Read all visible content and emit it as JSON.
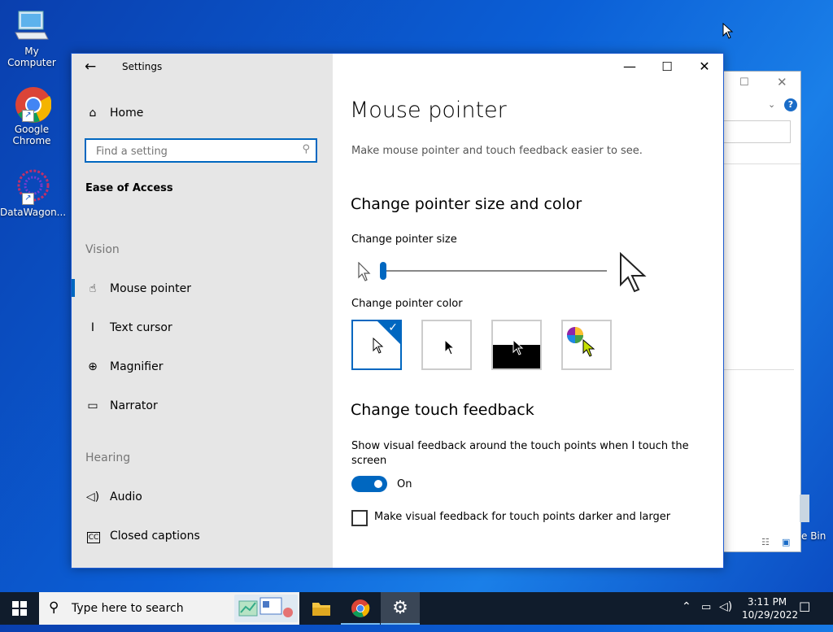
{
  "desktop": {
    "icons": [
      {
        "label": "My Computer"
      },
      {
        "label": "Google Chrome"
      },
      {
        "label": "DataWagon..."
      }
    ],
    "recycle_bin_label_partial": "e Bin"
  },
  "window": {
    "title": "Settings",
    "back_icon": "back-arrow-icon",
    "controls": {
      "minimize": "minimize-icon",
      "maximize": "maximize-icon",
      "close": "close-icon"
    }
  },
  "sidebar": {
    "home_label": "Home",
    "search_placeholder": "Find a setting",
    "category": "Ease of Access",
    "sections": [
      {
        "title": "Vision",
        "items": [
          {
            "label": "Mouse pointer",
            "icon": "mouse-pointer-icon",
            "selected": true
          },
          {
            "label": "Text cursor",
            "icon": "text-cursor-icon"
          },
          {
            "label": "Magnifier",
            "icon": "magnifier-icon"
          },
          {
            "label": "Narrator",
            "icon": "narrator-icon"
          }
        ]
      },
      {
        "title": "Hearing",
        "items": [
          {
            "label": "Audio",
            "icon": "audio-icon"
          },
          {
            "label": "Closed captions",
            "icon": "closed-captions-icon"
          }
        ]
      }
    ]
  },
  "main": {
    "title": "Mouse pointer",
    "subtitle": "Make mouse pointer and touch feedback easier to see.",
    "pointer_section": {
      "heading": "Change pointer size and color",
      "size_label": "Change pointer size",
      "size_value_fraction": 0.0,
      "color_label": "Change pointer color",
      "color_options": [
        {
          "name": "white",
          "selected": true
        },
        {
          "name": "black"
        },
        {
          "name": "inverted"
        },
        {
          "name": "custom"
        }
      ]
    },
    "touch_section": {
      "heading": "Change touch feedback",
      "show_feedback_label": "Show visual feedback around the touch points when I touch the screen",
      "toggle_state": "On",
      "darker_label": "Make visual feedback for touch points darker and larger",
      "darker_checked": false
    }
  },
  "colors": {
    "accent": "#0067c0",
    "sidebar_bg": "#e6e6e6",
    "taskbar_bg": "#101c2c"
  },
  "taskbar": {
    "search_placeholder": "Type here to search",
    "clock_time": "3:11 PM",
    "clock_date": "10/29/2022"
  }
}
